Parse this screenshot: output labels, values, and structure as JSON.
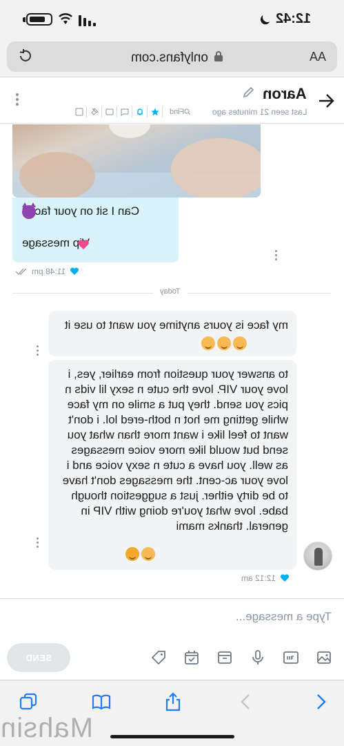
{
  "status": {
    "time": "12:42"
  },
  "browser": {
    "url": "onlyfans.com",
    "text_size_label": "AA"
  },
  "chat": {
    "contact_name": "Aaron",
    "last_seen": "Last seen 21 minutes ago",
    "find_label": "Find"
  },
  "messages": {
    "incoming": {
      "line1": "Can I sit on your face?",
      "line2": "Vip message",
      "time": "11:48 pm"
    },
    "divider": "Today",
    "outgoing": [
      {
        "text": "my face is yours anytime you want to use it"
      },
      {
        "text": "to answer your question from earlier, yes, i love your VIP. love the cute n sexy lil vids n pics you send. they put a smile on my face while getting me hot n both-ered lol. i don't want to feel like i want more than what you send but would like more voice messages as well. you have a cute n sexy voice and i love your ac-cent. the messages don't have to be dirty either. just a suggestion though babe. love what you're doing with VIP in general. thanks mami"
      }
    ],
    "outgoing_time": "12:12 am"
  },
  "composer": {
    "placeholder": "Type a message...",
    "send_label": "SEND"
  },
  "watermark": "Mahsin",
  "colors": {
    "accent": "#00aff0",
    "incoming_bubble": "#d9f3fa",
    "outgoing_bubble": "#f2f4f5",
    "meta_gray": "#8a96a3"
  }
}
